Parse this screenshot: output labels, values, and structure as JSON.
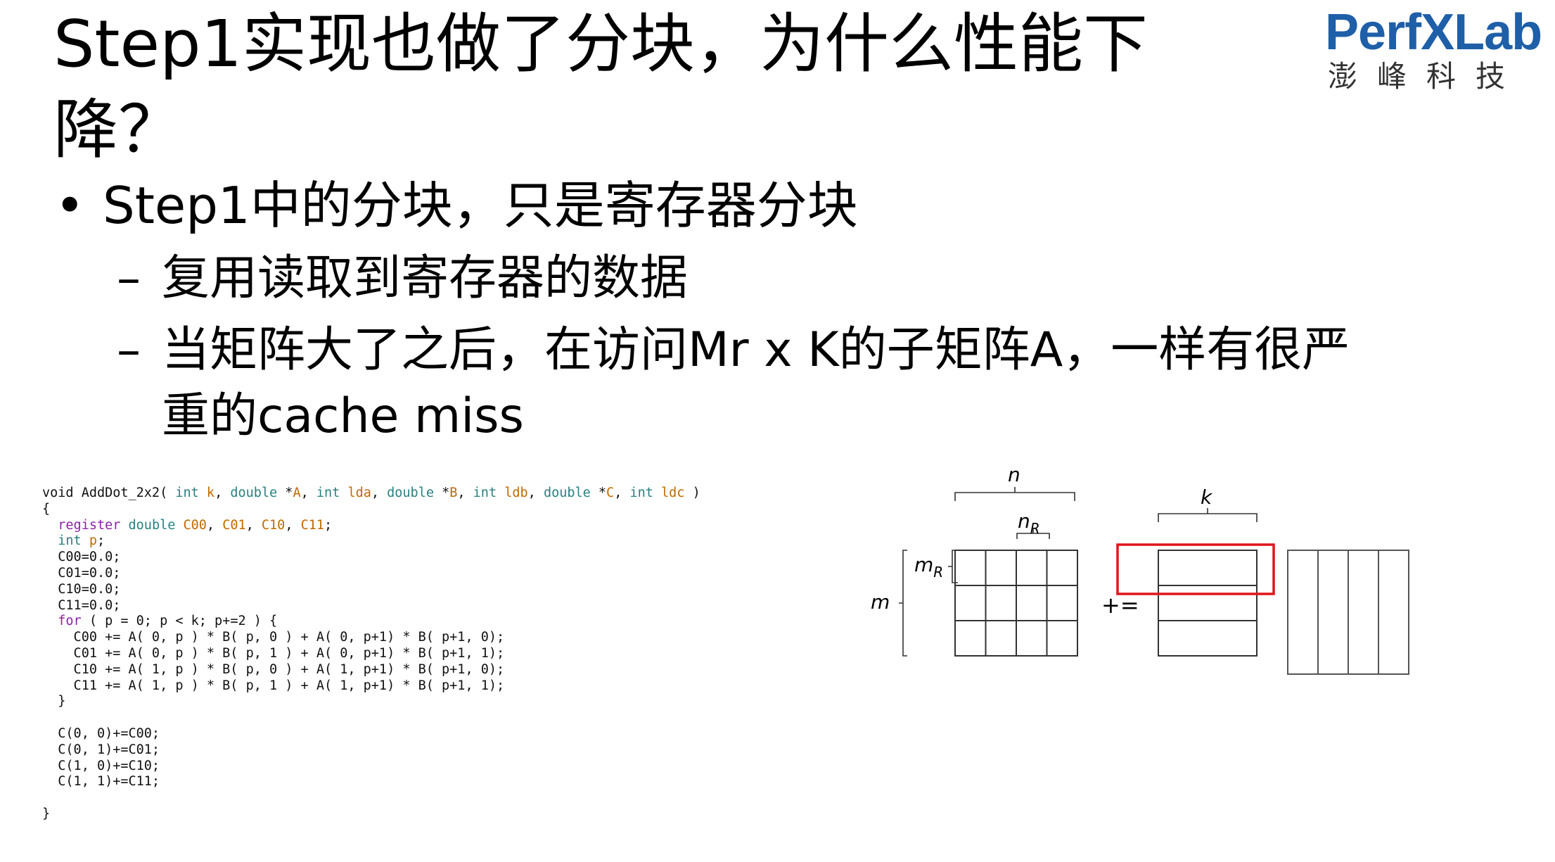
{
  "title": "Step1实现也做了分块，为什么性能下降？",
  "logo": {
    "brand_prefix": "Perf",
    "brand_x": "X",
    "brand_suffix": "Lab",
    "subtitle": "澎峰科技"
  },
  "bullet": {
    "text": "Step1中的分块，只是寄存器分块"
  },
  "subs": [
    {
      "dash": "–",
      "text": "复用读取到寄存器的数据"
    },
    {
      "dash": "–",
      "text": "当矩阵大了之后，在访问Mr x K的子矩阵A，一样有很严"
    },
    {
      "text": "重的cache miss"
    }
  ],
  "code": {
    "lines": [
      "void AddDot_2x2( int k, double *A, int lda, double *B, int ldb, double *C, int ldc )",
      "{",
      "  register double C00, C01, C10, C11;",
      "  int p;",
      "  C00=0.0;",
      "  C01=0.0;",
      "  C10=0.0;",
      "  C11=0.0;",
      "  for ( p = 0; p < k; p+=2 ) {",
      "    C00 += A( 0, p ) * B( p, 0 ) + A( 0, p+1) * B( p+1, 0);",
      "    C01 += A( 0, p ) * B( p, 1 ) + A( 0, p+1) * B( p+1, 1);",
      "    C10 += A( 1, p ) * B( p, 0 ) + A( 1, p+1) * B( p+1, 0);",
      "    C11 += A( 1, p ) * B( p, 1 ) + A( 1, p+1) * B( p+1, 1);",
      "  }",
      "",
      "  C(0, 0)+=C00;",
      "  C(0, 1)+=C01;",
      "  C(1, 0)+=C10;",
      "  C(1, 1)+=C11;",
      "",
      "}"
    ]
  },
  "diagram": {
    "label_n": "n",
    "label_nR_base": "n",
    "label_nR_sub": "R",
    "label_mR_base": "m",
    "label_mR_sub": "R",
    "label_m": "m",
    "label_k": "k",
    "operator": "+=",
    "highlight_color": "#e0151b"
  }
}
